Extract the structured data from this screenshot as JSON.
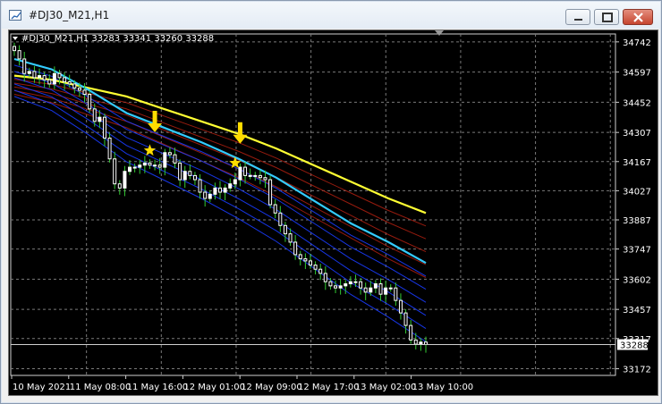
{
  "window": {
    "title": "#DJ30_M21,H1",
    "icon": "chart-window-icon",
    "controls": [
      "minimize-icon",
      "maximize-icon",
      "close-icon"
    ]
  },
  "chart_header": "#DJ30_M21,H1  33283 33341 33260 33288",
  "colors": {
    "background": "#000000",
    "grid": "#7a7a7a",
    "bull_candle": "#ffffff",
    "bear_candle": "#ffffff",
    "wick": "#33cc33",
    "slow_ma": "#ffff33",
    "fast_ma": "#33ccff",
    "red_ribbon": "#b02010",
    "blue_ribbon": "#1a3cff",
    "signal_arrow": "#ffdd00",
    "signal_star": "#ffdd00"
  },
  "current_price_label": "33288",
  "chart_data": {
    "type": "candlestick",
    "price_axis": {
      "ticks": [
        34742,
        34597,
        34452,
        34307,
        34167,
        34027,
        33887,
        33747,
        33602,
        33457,
        33317,
        33172
      ],
      "range": [
        33140,
        34780
      ]
    },
    "time_axis": {
      "labels": [
        "10 May 2021",
        "11 May 08:00",
        "11 May 16:00",
        "12 May 01:00",
        "12 May 09:00",
        "12 May 17:00",
        "13 May 02:00",
        "13 May 10:00"
      ]
    },
    "grid": true,
    "close_series": [
      34700,
      34660,
      34590,
      34600,
      34570,
      34580,
      34560,
      34540,
      34590,
      34570,
      34550,
      34540,
      34520,
      34510,
      34490,
      34420,
      34360,
      34380,
      34280,
      34180,
      34060,
      34040,
      34120,
      34140,
      34140,
      34150,
      34160,
      34150,
      34150,
      34140,
      34210,
      34200,
      34160,
      34080,
      34120,
      34100,
      34080,
      34020,
      33990,
      34010,
      34040,
      34020,
      34040,
      34060,
      34080,
      34140,
      34100,
      34100,
      34100,
      34090,
      34080,
      33960,
      33920,
      33860,
      33820,
      33780,
      33720,
      33700,
      33690,
      33670,
      33650,
      33630,
      33590,
      33570,
      33560,
      33570,
      33580,
      33590,
      33590,
      33560,
      33540,
      33560,
      33580,
      33530,
      33560,
      33560,
      33500,
      33440,
      33380,
      33310,
      33290,
      33300,
      33288
    ],
    "slow_ma": [
      34580,
      34560,
      34520,
      34480,
      34420,
      34360,
      34300,
      34230,
      34150,
      34070,
      33990,
      33920
    ],
    "fast_ma": [
      34660,
      34610,
      34510,
      34400,
      34330,
      34260,
      34180,
      34090,
      33980,
      33870,
      33780,
      33680
    ],
    "signals": [
      {
        "kind": "sell-arrow",
        "index": 28,
        "price": 34325
      },
      {
        "kind": "star",
        "index": 27,
        "price": 34220
      },
      {
        "kind": "sell-arrow",
        "index": 45,
        "price": 34270
      },
      {
        "kind": "star",
        "index": 44,
        "price": 34160
      }
    ]
  }
}
